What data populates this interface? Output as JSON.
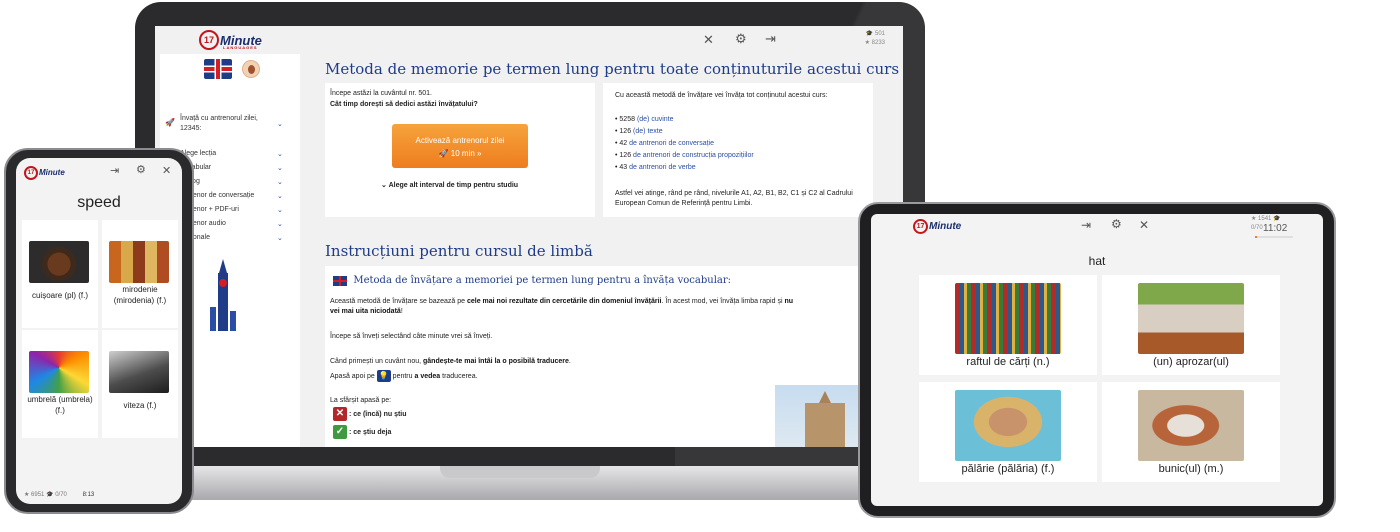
{
  "brand": {
    "logo_number": "17",
    "logo_word": "Minute",
    "logo_sub": "LANGUAGES"
  },
  "laptop": {
    "header_stats": {
      "stat1": "501",
      "stat2": "8233"
    },
    "sidebar": {
      "trainer_label": "Învață cu antrenorul zilei, 12345:",
      "items": [
        {
          "icon": "list-icon",
          "label": "Alege lecția"
        },
        {
          "icon": "vocabulary-icon",
          "label": "Vocabular"
        },
        {
          "icon": "dialog-icon",
          "label": "Dialog"
        },
        {
          "icon": "conversation-icon",
          "label": "Antrenor de conversație"
        },
        {
          "icon": "pdf-icon",
          "label": "Antrenor + PDF-uri"
        },
        {
          "icon": "audio-icon",
          "label": "Antrenor audio"
        },
        {
          "icon": "options-icon",
          "label": "Opționale"
        }
      ]
    },
    "main": {
      "heading1": "Metoda de memorie pe termen lung pentru toate conținuturile acestui curs",
      "left_card": {
        "line1": "Începe astăzi la cuvântul nr. 501.",
        "line2": "Cât timp dorești să dedici astăzi învățatului?",
        "cta_title": "Activează antrenorul zilei",
        "cta_sub": "10 min »",
        "alt_interval": "Alege alt interval de timp pentru studiu"
      },
      "right_card": {
        "intro": "Cu această metodă de învățare vei învăța tot conținutul acestui curs:",
        "items": [
          {
            "count": "5258",
            "text": "(de) cuvinte"
          },
          {
            "count": "126",
            "text": "(de) texte"
          },
          {
            "count": "42",
            "text": "de antrenori de conversație"
          },
          {
            "count": "126",
            "text": "de antrenori de construcția propozițiilor"
          },
          {
            "count": "43",
            "text": "de antrenori de verbe"
          }
        ],
        "outro": "Astfel vei atinge, rând pe rând, nivelurile A1, A2, B1, B2, C1 și C2 al Cadrului European Comun de Referință pentru Limbi."
      },
      "heading2": "Instrucțiuni pentru cursul de limbă",
      "instr": {
        "subheading": "Metoda de învățare a memoriei pe termen lung pentru a învăța vocabular:",
        "p1_a": "Această metodă de învățare se bazează pe ",
        "p1_b": "cele mai noi rezultate din cercetările din domeniul învățării",
        "p1_c": ". În acest mod, vei învăța limba rapid și ",
        "p1_d": "nu",
        "p1_e": "vei mai uita niciodată",
        "p1_f": "!",
        "p2": "Începe să înveți selectând câte minute vrei să înveți.",
        "p3_a": "Când primești un cuvânt nou, ",
        "p3_b": "gândește-te mai întâi la o posibilă traducere",
        "p3_c": ".",
        "p4_a": "Apasă apoi pe",
        "p4_b": "pentru",
        "p4_c": "a vedea",
        "p4_d": "traducerea.",
        "p5": "La sfârșit apasă pe:",
        "dont_know": ": ce (încă) nu știu",
        "know": ": ce știu deja"
      }
    }
  },
  "phone": {
    "word": "speed",
    "cards": [
      {
        "caption": "cuișoare (pl) (f.)",
        "image": "cloves-image"
      },
      {
        "caption": "mirodenie (mirodenia) (f.)",
        "image": "spices-image"
      },
      {
        "caption": "umbrelă (umbrela) (f.)",
        "image": "umbrella-image"
      },
      {
        "caption": "viteza (f.)",
        "image": "speedometer-image"
      }
    ],
    "footer_stat1": "6951",
    "footer_stat2": "0/70",
    "timer": "8:13"
  },
  "tablet": {
    "word": "hat",
    "stat1": "1541",
    "stat2": "0/70",
    "timer": "11:02",
    "cards": [
      {
        "caption": "raftul de cărți (n.)",
        "image": "bookshelf-image"
      },
      {
        "caption": "(un) aprozar(ul)",
        "image": "greengrocer-image"
      },
      {
        "caption": "pălărie (pălăria) (f.)",
        "image": "sunhat-woman-image"
      },
      {
        "caption": "bunic(ul) (m.)",
        "image": "grandfather-image"
      }
    ]
  }
}
